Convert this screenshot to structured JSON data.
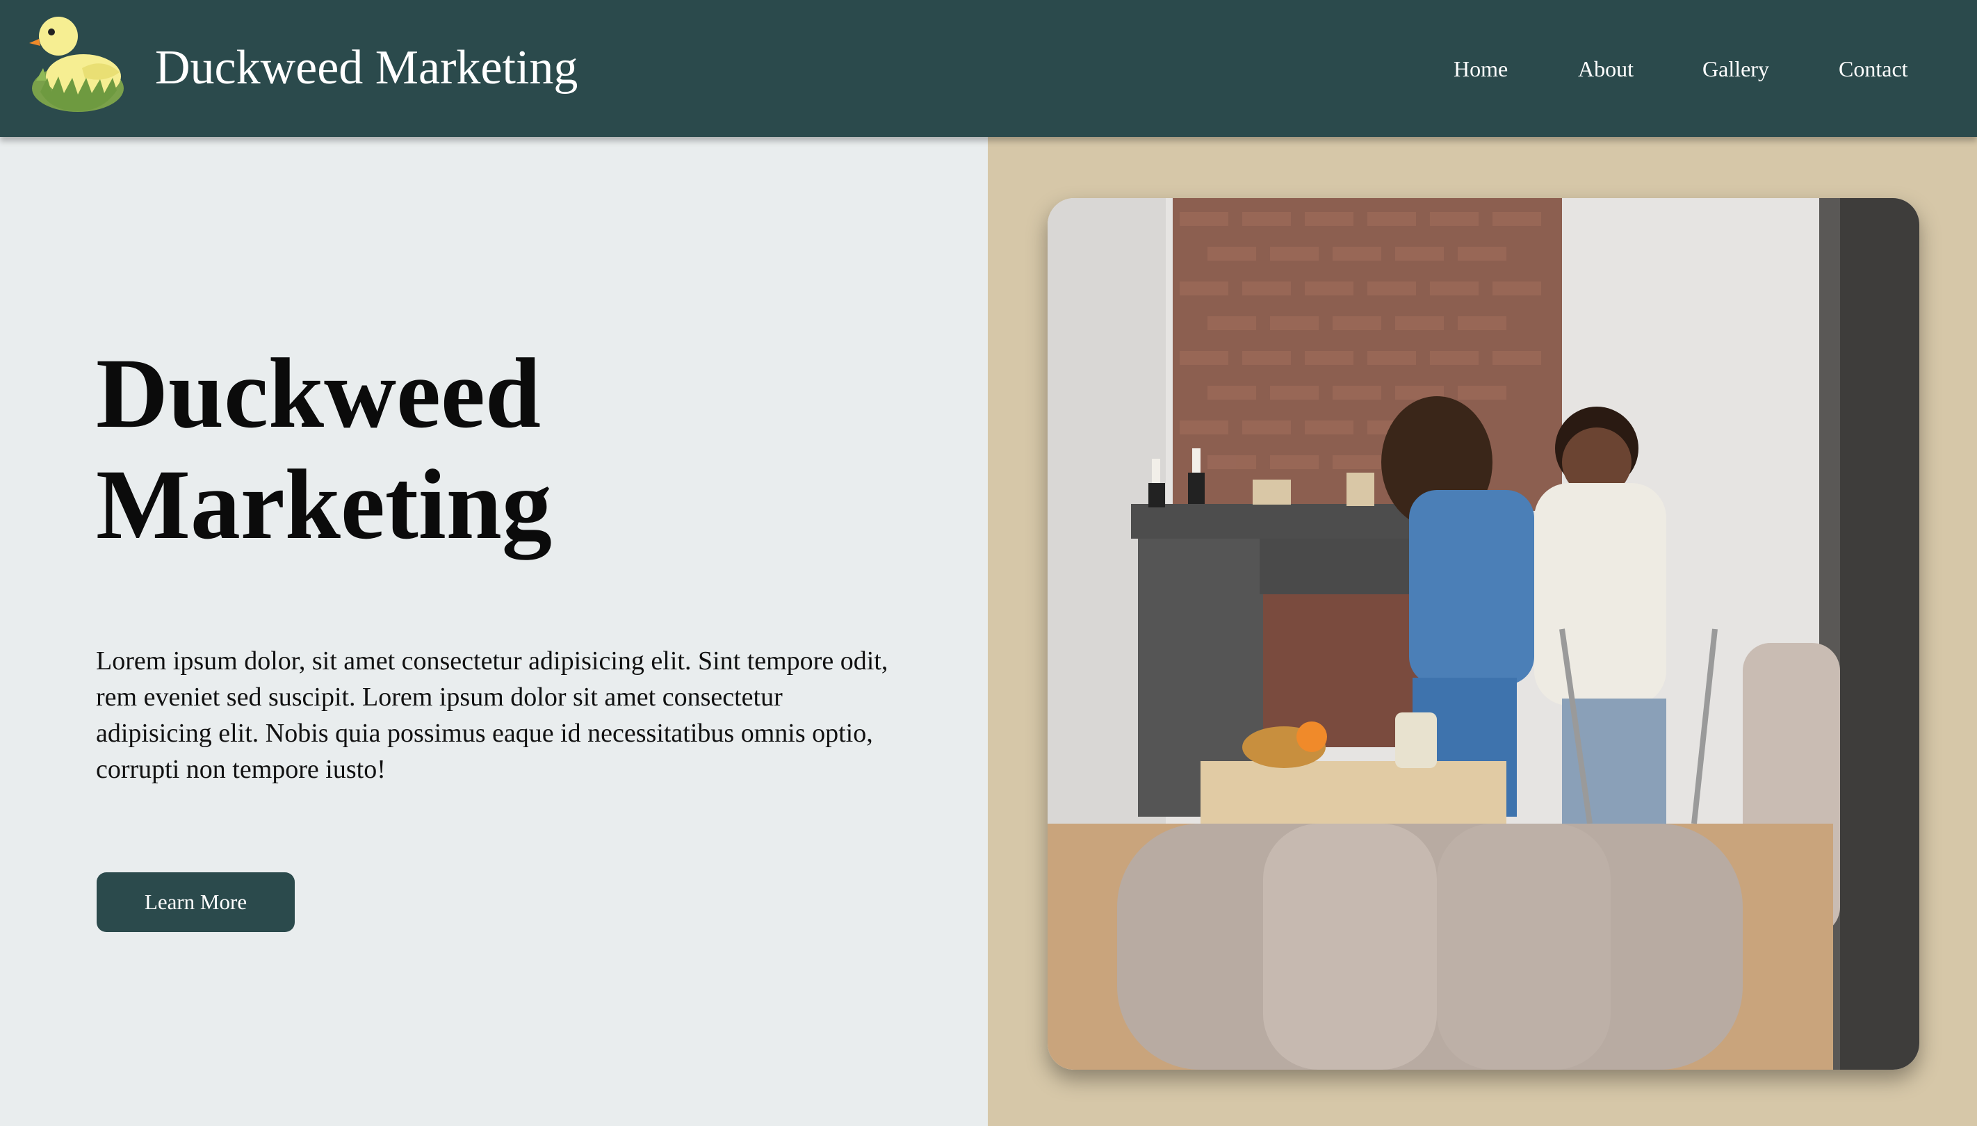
{
  "header": {
    "brand": "Duckweed Marketing",
    "logo_icon": "duck-logo-icon",
    "nav": [
      "Home",
      "About",
      "Gallery",
      "Contact"
    ]
  },
  "hero": {
    "title_line1": "Duckweed",
    "title_line2": "Marketing",
    "text": "Lorem ipsum dolor, sit amet consectetur adipisicing elit. Sint tempore odit, rem eveniet sed suscipit. Lorem ipsum dolor sit amet consectetur adipisicing elit. Nobis quia possimus eaque id necessitatibus omnis optio, corrupti non tempore iusto!",
    "button": "Learn More"
  },
  "colors": {
    "header_bg": "#2b4a4c",
    "page_bg": "#e9edee",
    "accent_panel": "#d6c7a8",
    "button_bg": "#2b4a4c"
  }
}
